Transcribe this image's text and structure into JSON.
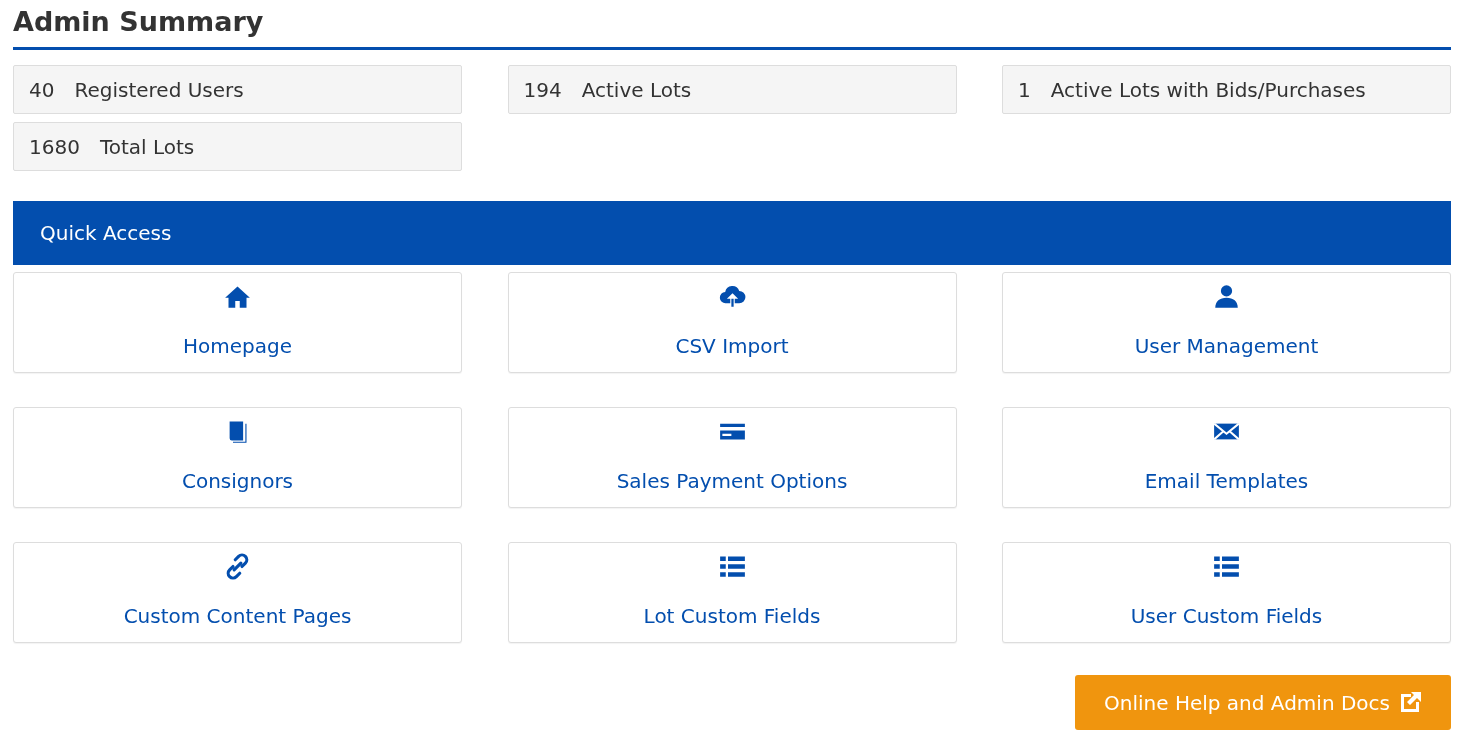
{
  "title": "Admin Summary",
  "stats": [
    {
      "count": "40",
      "label": "Registered Users"
    },
    {
      "count": "194",
      "label": "Active Lots"
    },
    {
      "count": "1",
      "label": "Active Lots with Bids/Purchases"
    },
    {
      "count": "1680",
      "label": "Total Lots"
    }
  ],
  "quick_access": {
    "heading": "Quick Access",
    "tiles": [
      {
        "label": "Homepage"
      },
      {
        "label": "CSV Import"
      },
      {
        "label": "User Management"
      },
      {
        "label": "Consignors"
      },
      {
        "label": "Sales Payment Options"
      },
      {
        "label": "Email Templates"
      },
      {
        "label": "Custom Content Pages"
      },
      {
        "label": "Lot Custom Fields"
      },
      {
        "label": "User Custom Fields"
      }
    ]
  },
  "help_button": "Online Help and Admin Docs"
}
